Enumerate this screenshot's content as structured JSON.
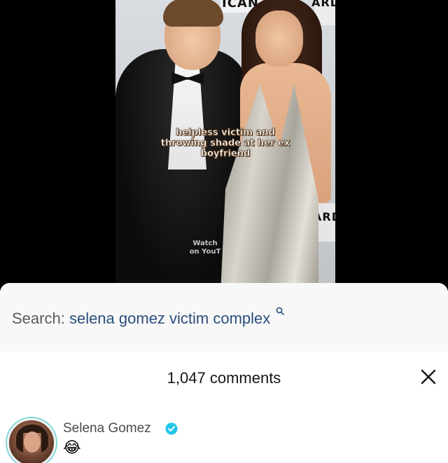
{
  "video": {
    "caption": "helpless victim and throwing shade at her ex boyfriend",
    "watermark_line1": "Watch",
    "watermark_line2": "on YouT",
    "sign_top_left": "ICAN",
    "sign_top_right": "ARD",
    "sign_mid_right": "ARDS"
  },
  "search": {
    "prefix": "Search:",
    "query": "selena gomez victim complex",
    "icon": "search-icon"
  },
  "comments": {
    "count_label": "1,047 comments",
    "close_icon": "close-icon",
    "items": [
      {
        "author": "Selena Gomez",
        "verified": true,
        "text": "😂"
      }
    ]
  },
  "colors": {
    "search_query": "#2a4e7c",
    "verified": "#20c5e8",
    "avatar_ring": "#7fd6d6"
  }
}
